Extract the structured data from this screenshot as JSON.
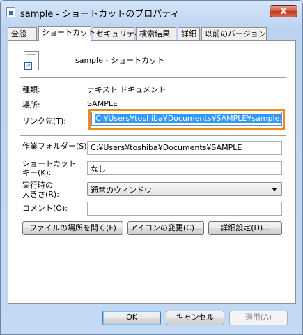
{
  "window": {
    "title": "sample - ショートカットのプロパティ",
    "close_label": "X"
  },
  "tabs": [
    {
      "label": "全般"
    },
    {
      "label": "ショートカット"
    },
    {
      "label": "セキュリティ"
    },
    {
      "label": "検索結果"
    },
    {
      "label": "詳細"
    },
    {
      "label": "以前のバージョン"
    }
  ],
  "shortcut": {
    "name": "sample - ショートカット",
    "type_label": "種類:",
    "type_value": "テキスト ドキュメント",
    "location_label": "場所:",
    "location_value": "SAMPLE",
    "target_label": "リンク先(T):",
    "target_value": "C:¥Users¥toshiba¥Documents¥SAMPLE¥sample.txt",
    "workdir_label": "作業フォルダー(S):",
    "workdir_value": "C:¥Users¥toshiba¥Documents¥SAMPLE",
    "hotkey_label_1": "ショートカット",
    "hotkey_label_2": "キー(K):",
    "hotkey_value": "なし",
    "run_label_1": "実行時の",
    "run_label_2": "大きさ(R):",
    "run_value": "通常のウィンドウ",
    "comment_label": "コメント(O):",
    "comment_value": ""
  },
  "actions": {
    "open_location": "ファイルの場所を開く(F)",
    "change_icon": "アイコンの変更(C)...",
    "advanced": "詳細設定(D)..."
  },
  "footer": {
    "ok": "OK",
    "cancel": "キャンセル",
    "apply": "適用(A)"
  },
  "colors": {
    "highlight_border": "#f08a1c",
    "selection": "#3399ff"
  }
}
